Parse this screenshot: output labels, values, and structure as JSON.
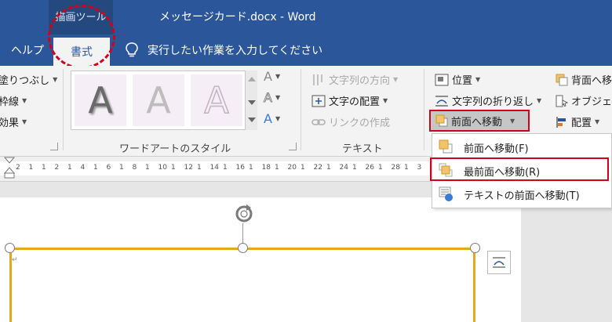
{
  "titlebar": {
    "contextual_tab": "描画ツール",
    "doc_title": "メッセージカード.docx  -  Word"
  },
  "tabs": {
    "help": "ヘルプ",
    "format": "書式",
    "tell_me": "実行したい作業を入力してください"
  },
  "ribbon": {
    "shape_styles": {
      "fill": "塗りつぶし",
      "outline": "枠線",
      "effects": "効果"
    },
    "wordart": {
      "sample": "A",
      "group_label": "ワードアートのスタイル",
      "text_fill_letter": "A"
    },
    "text": {
      "direction": "文字列の方向",
      "align": "文字の配置",
      "link": "リンクの作成",
      "group_label": "テキスト"
    },
    "arrange": {
      "position": "位置",
      "wrap": "文字列の折り返し",
      "bring_forward": "前面へ移動",
      "send_backward": "背面へ移",
      "selection_pane": "オブジェク",
      "align": "配置"
    }
  },
  "ruler": {
    "ticks": [
      "2",
      "1",
      "1",
      "2",
      "1",
      "4",
      "1",
      "6",
      "1",
      "8",
      "1",
      "10",
      "1",
      "12",
      "1",
      "14",
      "1",
      "16",
      "1",
      "18",
      "1",
      "20",
      "1",
      "22",
      "1",
      "24",
      "1",
      "26",
      "1",
      "28",
      "1",
      "3"
    ]
  },
  "menu": {
    "items": [
      {
        "label": "前面へ移動(F)"
      },
      {
        "label": "最前面へ移動(R)"
      },
      {
        "label": "テキストの前面へ移動(T)"
      }
    ]
  },
  "colors": {
    "word_blue": "#2b579a",
    "highlight_red": "#d0021b",
    "shape_outline": "#e2a91d"
  }
}
